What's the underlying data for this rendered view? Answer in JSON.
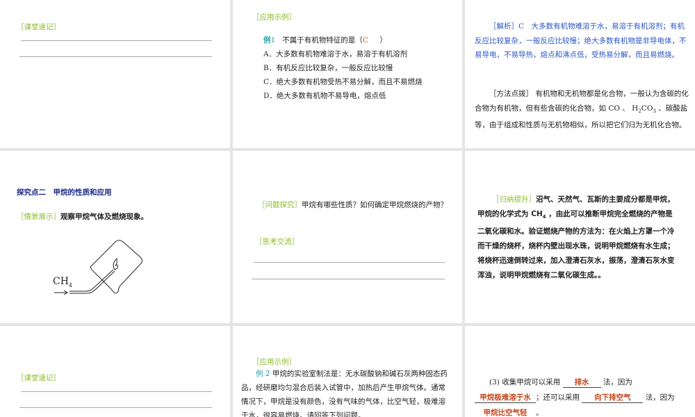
{
  "slides": {
    "s1": {
      "label": "［课堂速记］"
    },
    "s2": {
      "label": "［应用示例］",
      "example_tag": "例",
      "example_num": "1",
      "question": "不属于有机物特征的是（",
      "answer": "C",
      "question_end": "）",
      "options": [
        "A．大多数有机物难溶于水，易溶于有机溶剂",
        "B．有机反应比较复杂，一般反应比较慢",
        "C．绝大多数有机物受热不易分解，而且不易燃烧",
        "D．绝大多数有机物不易导电，熔点低"
      ]
    },
    "s3": {
      "analysis": "［解析］C　大多数有机物难溶于水，易溶于有机溶剂；有机反应比较复杂，一般反应比较慢；绝大多数有机物是非导电体，不易导电，不易导热，熔点和沸点低，受热易分解，而且易燃烧。",
      "method_label": "［方法点拨］",
      "method_text_1": "有机物和无机物都是化合物，一般认为含碳的化合物为有机物，但有些含碳的化合物，如 CO 、 H",
      "h2co3_sub1": "2",
      "h2co3_mid": "CO",
      "h2co3_sub2": "3",
      "method_text_2": " 、碳酸盐等，由于组成和性质与无机物相似，所以把它们归为无机化合物。"
    },
    "s4": {
      "title": "探究点二　甲烷的性质和应用",
      "label": "［情景展示］",
      "text": "观察甲烷气体及燃烧现象。",
      "diagram_label": "CH",
      "diagram_sub": "4"
    },
    "s5": {
      "label": "［问题探究］",
      "text": "甲烷有哪些性质？如何确定甲烷燃烧的产物？",
      "label2": "［思考交流］"
    },
    "s6": {
      "label": "［归纳提升］",
      "text_1": "沼气、天然气、瓦斯的主要成分都是甲烷，甲烷的化学式为 CH",
      "sub": "4",
      "text_2": " ，由此可以推断甲烷完全燃烧的产物是二氧化碳和水。验证燃烧产物的方法为：在火焰上方罩一个冷而干燥的烧杯，烧杯内壁出现水珠，说明甲烷燃烧有水生成；将烧杯迅速倒转过来，加入澄清石灰水，振荡，澄清石灰水变浑浊，说明甲烷燃烧有二氧化碳生成。。"
    },
    "s7": {
      "label": "［课堂速记］"
    },
    "s8": {
      "label": "［应用示例］",
      "example_tag": "例 2",
      "text": "甲烷的实验室制法是：无水碳酸钠和碱石灰两种固态药品，经研磨均匀混合后装入试管中，加热后产生甲烷气体。通常情况下，甲烷是没有颜色，没有气味的气体，比空气轻，极难溶于水，很容易燃烧。请回答下列问题。"
    },
    "s9": {
      "q_prefix": "(3) 收集甲烷可以采用",
      "blank1": "排水",
      "t1": "法，因为",
      "blank2": "甲烷极难溶于水",
      "t2": "；还可以采用",
      "blank3": "向下排空气",
      "t3": "法，因为",
      "blank4": "甲烷比空气轻",
      "t4": "。"
    }
  }
}
